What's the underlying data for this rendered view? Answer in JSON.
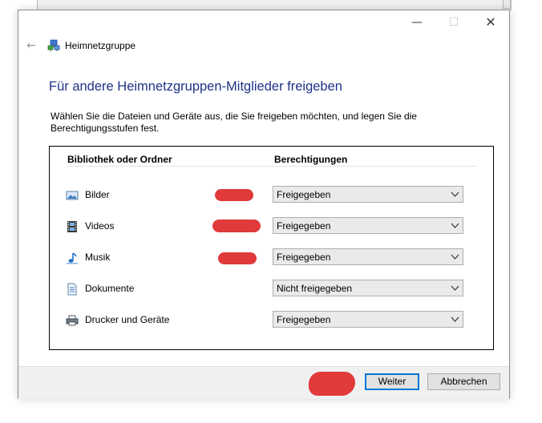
{
  "window": {
    "title": "Heimnetzgruppe",
    "controls": {
      "minimize": "—",
      "maximize": "☐",
      "close": "✕"
    },
    "back_icon": "arrow-left-icon"
  },
  "heading": "Für andere Heimnetzgruppen-Mitglieder freigeben",
  "description": "Wählen Sie die Dateien und Geräte aus, die Sie freigeben möchten, und legen Sie die Berechtigungsstufen fest.",
  "table": {
    "columns": [
      "Bibliothek oder Ordner",
      "Berechtigungen"
    ],
    "rows": [
      {
        "label": "Bilder",
        "icon": "pictures-icon",
        "permission": "Freigegeben"
      },
      {
        "label": "Videos",
        "icon": "videos-icon",
        "permission": "Freigegeben"
      },
      {
        "label": "Musik",
        "icon": "music-icon",
        "permission": "Freigegeben"
      },
      {
        "label": "Dokumente",
        "icon": "documents-icon",
        "permission": "Nicht freigegeben"
      },
      {
        "label": "Drucker und Geräte",
        "icon": "printer-icon",
        "permission": "Freigegeben"
      }
    ]
  },
  "footer": {
    "next_label": "Weiter",
    "cancel_label": "Abbrechen"
  },
  "colors": {
    "heading": "#1e3287",
    "accent": "#0078d7",
    "redaction": "#e03a3a"
  }
}
